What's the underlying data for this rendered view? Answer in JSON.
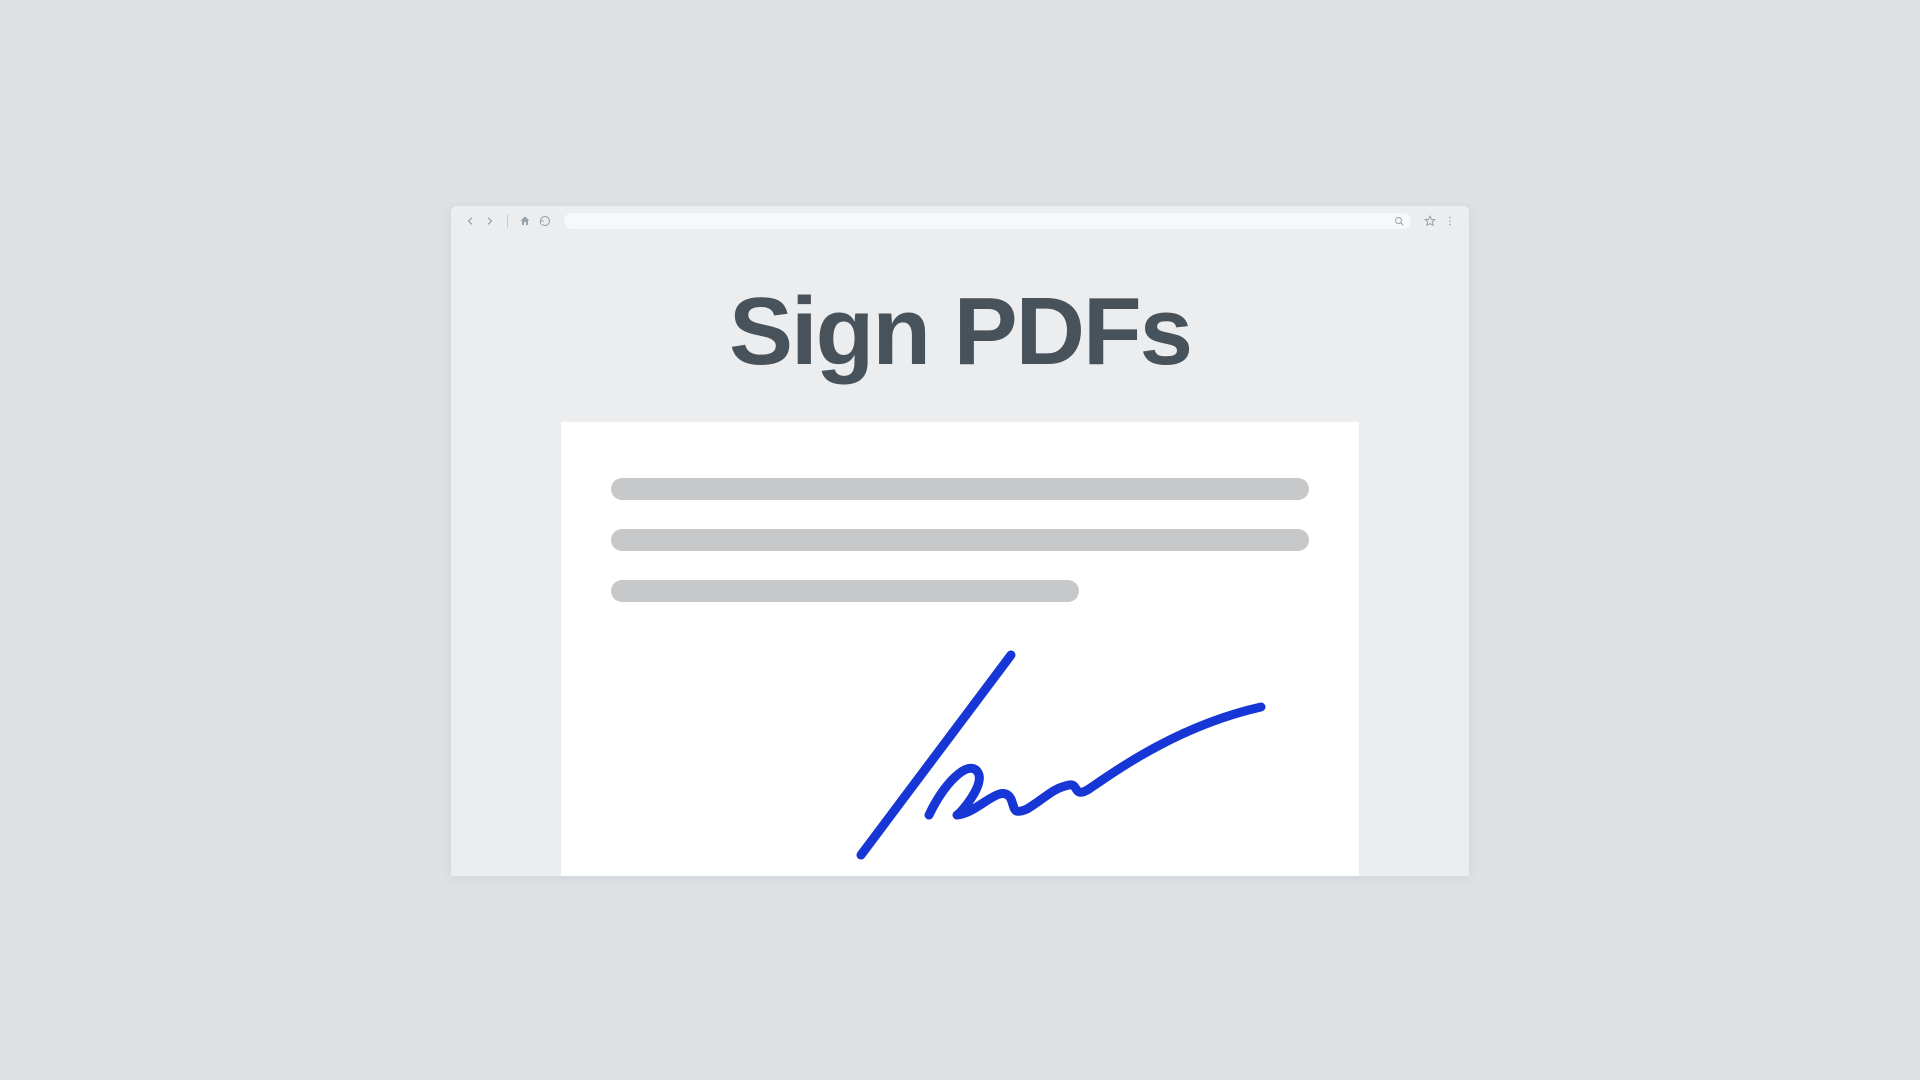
{
  "page": {
    "title": "Sign PDFs"
  },
  "colors": {
    "signature": "#1636d6",
    "title": "#48525a",
    "docLine": "#c7c8c9",
    "pageBg": "#dde1e4",
    "windowBg": "#ebedef"
  },
  "address_bar": {
    "value": "",
    "placeholder": ""
  }
}
